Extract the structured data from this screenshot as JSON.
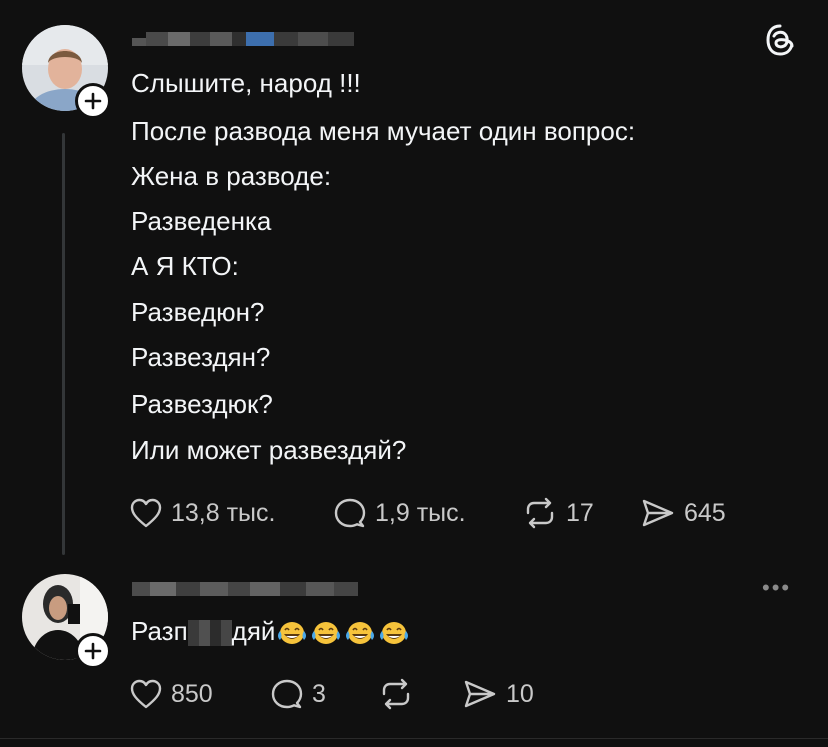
{
  "post": {
    "lines": [
      "Слышите, народ !!!",
      "После развода меня мучает один вопрос:",
      "Жена в разводе:",
      "Разведенка",
      "А Я КТО:",
      "Разведюн?",
      "Развездян?",
      "Развездюк?",
      "Или может развездяй?"
    ],
    "likes": "13,8 тыс.",
    "comments": "1,9 тыс.",
    "reposts": "17",
    "shares": "645"
  },
  "reply": {
    "text_start": "Разп",
    "text_end": "дяй",
    "emoji": [
      "laughing-tears-emoji",
      "laughing-tears-emoji",
      "laughing-tears-emoji",
      "laughing-tears-emoji"
    ],
    "likes": "850",
    "comments": "3",
    "shares": "10",
    "menu": "•••"
  },
  "colors": {
    "background": "#101010",
    "text": "#f3f5f7",
    "muted": "#c9c9c9"
  }
}
